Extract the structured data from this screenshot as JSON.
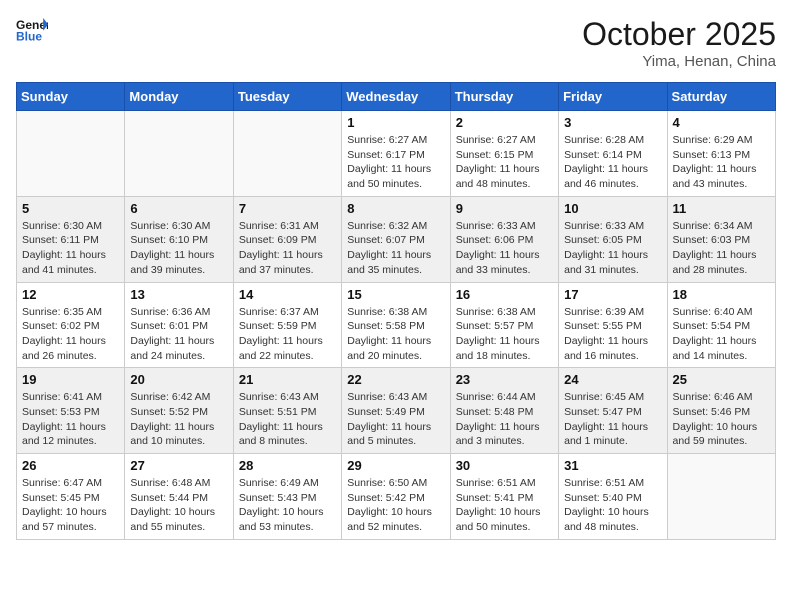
{
  "header": {
    "logo": {
      "line1": "General",
      "line2": "Blue"
    },
    "title": "October 2025",
    "location": "Yima, Henan, China"
  },
  "days_of_week": [
    "Sunday",
    "Monday",
    "Tuesday",
    "Wednesday",
    "Thursday",
    "Friday",
    "Saturday"
  ],
  "weeks": [
    [
      {
        "day": "",
        "info": ""
      },
      {
        "day": "",
        "info": ""
      },
      {
        "day": "",
        "info": ""
      },
      {
        "day": "1",
        "info": "Sunrise: 6:27 AM\nSunset: 6:17 PM\nDaylight: 11 hours\nand 50 minutes."
      },
      {
        "day": "2",
        "info": "Sunrise: 6:27 AM\nSunset: 6:15 PM\nDaylight: 11 hours\nand 48 minutes."
      },
      {
        "day": "3",
        "info": "Sunrise: 6:28 AM\nSunset: 6:14 PM\nDaylight: 11 hours\nand 46 minutes."
      },
      {
        "day": "4",
        "info": "Sunrise: 6:29 AM\nSunset: 6:13 PM\nDaylight: 11 hours\nand 43 minutes."
      }
    ],
    [
      {
        "day": "5",
        "info": "Sunrise: 6:30 AM\nSunset: 6:11 PM\nDaylight: 11 hours\nand 41 minutes."
      },
      {
        "day": "6",
        "info": "Sunrise: 6:30 AM\nSunset: 6:10 PM\nDaylight: 11 hours\nand 39 minutes."
      },
      {
        "day": "7",
        "info": "Sunrise: 6:31 AM\nSunset: 6:09 PM\nDaylight: 11 hours\nand 37 minutes."
      },
      {
        "day": "8",
        "info": "Sunrise: 6:32 AM\nSunset: 6:07 PM\nDaylight: 11 hours\nand 35 minutes."
      },
      {
        "day": "9",
        "info": "Sunrise: 6:33 AM\nSunset: 6:06 PM\nDaylight: 11 hours\nand 33 minutes."
      },
      {
        "day": "10",
        "info": "Sunrise: 6:33 AM\nSunset: 6:05 PM\nDaylight: 11 hours\nand 31 minutes."
      },
      {
        "day": "11",
        "info": "Sunrise: 6:34 AM\nSunset: 6:03 PM\nDaylight: 11 hours\nand 28 minutes."
      }
    ],
    [
      {
        "day": "12",
        "info": "Sunrise: 6:35 AM\nSunset: 6:02 PM\nDaylight: 11 hours\nand 26 minutes."
      },
      {
        "day": "13",
        "info": "Sunrise: 6:36 AM\nSunset: 6:01 PM\nDaylight: 11 hours\nand 24 minutes."
      },
      {
        "day": "14",
        "info": "Sunrise: 6:37 AM\nSunset: 5:59 PM\nDaylight: 11 hours\nand 22 minutes."
      },
      {
        "day": "15",
        "info": "Sunrise: 6:38 AM\nSunset: 5:58 PM\nDaylight: 11 hours\nand 20 minutes."
      },
      {
        "day": "16",
        "info": "Sunrise: 6:38 AM\nSunset: 5:57 PM\nDaylight: 11 hours\nand 18 minutes."
      },
      {
        "day": "17",
        "info": "Sunrise: 6:39 AM\nSunset: 5:55 PM\nDaylight: 11 hours\nand 16 minutes."
      },
      {
        "day": "18",
        "info": "Sunrise: 6:40 AM\nSunset: 5:54 PM\nDaylight: 11 hours\nand 14 minutes."
      }
    ],
    [
      {
        "day": "19",
        "info": "Sunrise: 6:41 AM\nSunset: 5:53 PM\nDaylight: 11 hours\nand 12 minutes."
      },
      {
        "day": "20",
        "info": "Sunrise: 6:42 AM\nSunset: 5:52 PM\nDaylight: 11 hours\nand 10 minutes."
      },
      {
        "day": "21",
        "info": "Sunrise: 6:43 AM\nSunset: 5:51 PM\nDaylight: 11 hours\nand 8 minutes."
      },
      {
        "day": "22",
        "info": "Sunrise: 6:43 AM\nSunset: 5:49 PM\nDaylight: 11 hours\nand 5 minutes."
      },
      {
        "day": "23",
        "info": "Sunrise: 6:44 AM\nSunset: 5:48 PM\nDaylight: 11 hours\nand 3 minutes."
      },
      {
        "day": "24",
        "info": "Sunrise: 6:45 AM\nSunset: 5:47 PM\nDaylight: 11 hours\nand 1 minute."
      },
      {
        "day": "25",
        "info": "Sunrise: 6:46 AM\nSunset: 5:46 PM\nDaylight: 10 hours\nand 59 minutes."
      }
    ],
    [
      {
        "day": "26",
        "info": "Sunrise: 6:47 AM\nSunset: 5:45 PM\nDaylight: 10 hours\nand 57 minutes."
      },
      {
        "day": "27",
        "info": "Sunrise: 6:48 AM\nSunset: 5:44 PM\nDaylight: 10 hours\nand 55 minutes."
      },
      {
        "day": "28",
        "info": "Sunrise: 6:49 AM\nSunset: 5:43 PM\nDaylight: 10 hours\nand 53 minutes."
      },
      {
        "day": "29",
        "info": "Sunrise: 6:50 AM\nSunset: 5:42 PM\nDaylight: 10 hours\nand 52 minutes."
      },
      {
        "day": "30",
        "info": "Sunrise: 6:51 AM\nSunset: 5:41 PM\nDaylight: 10 hours\nand 50 minutes."
      },
      {
        "day": "31",
        "info": "Sunrise: 6:51 AM\nSunset: 5:40 PM\nDaylight: 10 hours\nand 48 minutes."
      },
      {
        "day": "",
        "info": ""
      }
    ]
  ]
}
